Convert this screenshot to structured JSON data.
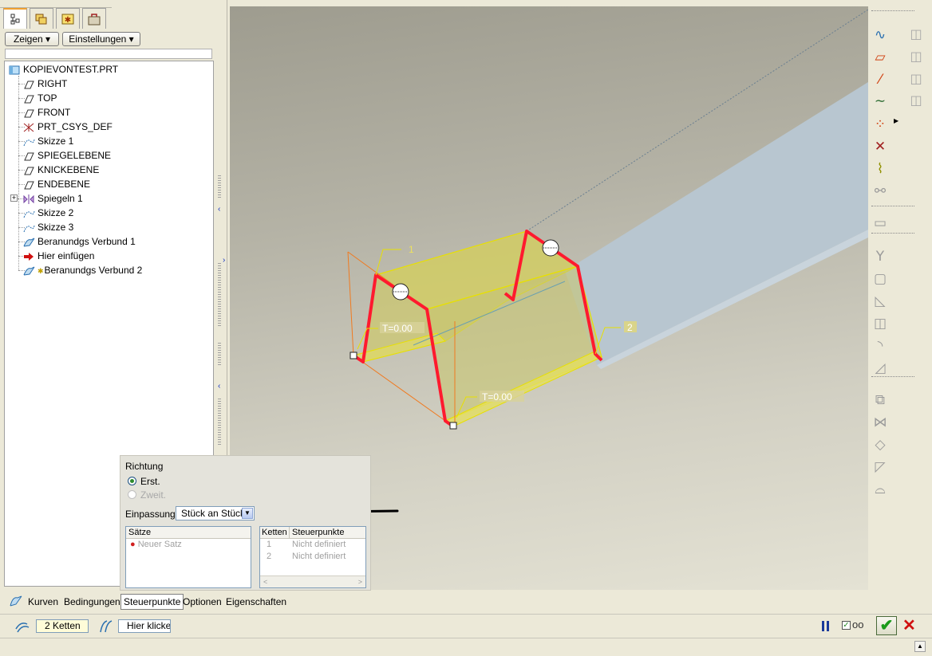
{
  "tree_tabs": [
    "model-tree-tab",
    "layer-tab",
    "favorites-tab",
    "tools-tab"
  ],
  "tree_toolbar": {
    "show_label": "Zeigen ▾",
    "settings_label": "Einstellungen ▾"
  },
  "tree": {
    "root": "KOPIEVONTEST.PRT",
    "items": [
      {
        "label": "RIGHT",
        "icon": "datum-plane-icon"
      },
      {
        "label": "TOP",
        "icon": "datum-plane-icon"
      },
      {
        "label": "FRONT",
        "icon": "datum-plane-icon"
      },
      {
        "label": "PRT_CSYS_DEF",
        "icon": "coordinate-system-icon"
      },
      {
        "label": "Skizze 1",
        "icon": "sketch-icon"
      },
      {
        "label": "SPIEGELEBENE",
        "icon": "datum-plane-icon"
      },
      {
        "label": "KNICKEBENE",
        "icon": "datum-plane-icon"
      },
      {
        "label": "ENDEBENE",
        "icon": "datum-plane-icon"
      },
      {
        "label": "Spiegeln 1",
        "icon": "mirror-icon"
      },
      {
        "label": "Skizze 2",
        "icon": "sketch-icon"
      },
      {
        "label": "Skizze 3",
        "icon": "sketch-icon"
      },
      {
        "label": "Beranundgs Verbund 1",
        "icon": "boundary-blend-icon"
      },
      {
        "label": "Hier einfügen",
        "icon": "insert-arrow-icon"
      },
      {
        "label": "Beranundgs Verbund 2",
        "icon": "boundary-blend-icon"
      }
    ]
  },
  "viewport": {
    "label_1": "1",
    "label_2": "2",
    "tension_1": "T=0.00",
    "tension_2": "T=0.00",
    "colors": {
      "highlight": "#e8e000",
      "chain": "#ff1a2e",
      "body": "#b8c8d4",
      "orange": "#f07a20"
    }
  },
  "dash": {
    "direction_title": "Richtung",
    "first_label": "Erst.",
    "second_label": "Zweit.",
    "fit_label": "Einpassung",
    "fit_value": "Stück an Stück",
    "sets_header": "Sätze",
    "sets_items": [
      "Neuer Satz"
    ],
    "chains_header": "Ketten",
    "control_header": "Steuerpunkte",
    "rows": [
      {
        "chain": "1",
        "value": "Nicht definiert"
      },
      {
        "chain": "2",
        "value": "Nicht definiert"
      }
    ]
  },
  "dash_tabs": {
    "curves": "Kurven",
    "conditions": "Bedingungen",
    "control_points": "Steuerpunkte",
    "options": "Optionen",
    "properties": "Eigenschaften"
  },
  "status": {
    "chains_value": "2 Ketten",
    "click_here": "Hier klicken"
  }
}
